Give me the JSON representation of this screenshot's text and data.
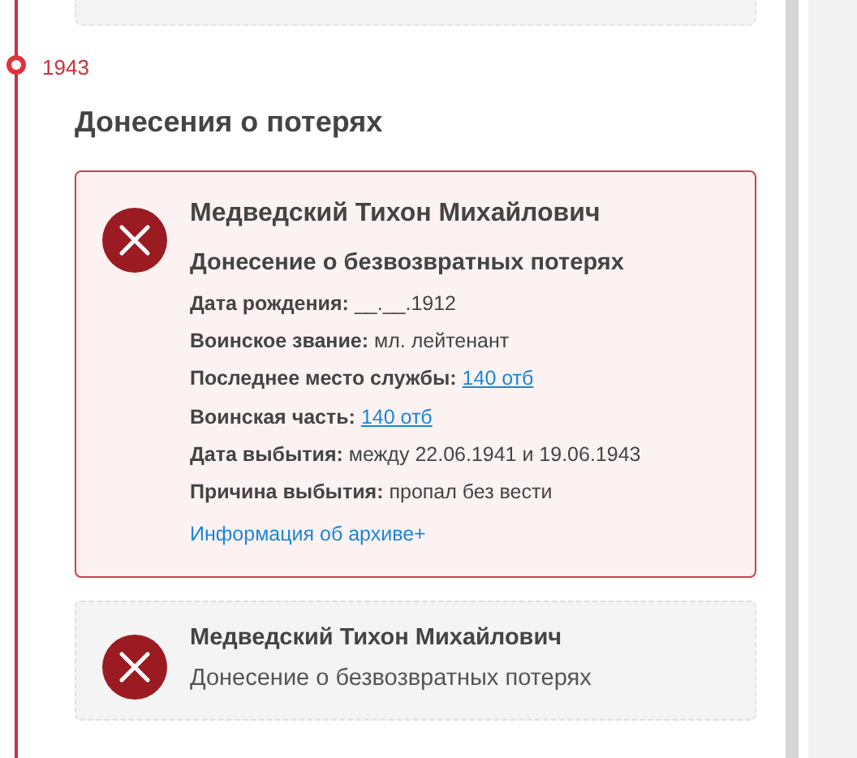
{
  "timeline": {
    "year": "1943"
  },
  "section_title": "Донесения о потерях",
  "reports": [
    {
      "name": "Медведский Тихон Михайлович",
      "doc_type": "Донесение о безвозвратных потерях",
      "selected": true,
      "fields": [
        {
          "label": "Дата рождения:",
          "value": "__.__.1912",
          "kind": "text"
        },
        {
          "label": "Воинское звание:",
          "value": "мл. лейтенант",
          "kind": "text"
        },
        {
          "label": "Последнее место службы:",
          "value": "140 отб",
          "kind": "link"
        },
        {
          "label": "Воинская часть:",
          "value": "140 отб",
          "kind": "link"
        },
        {
          "label": "Дата выбытия:",
          "value": "между 22.06.1941 и 19.06.1943",
          "kind": "text"
        },
        {
          "label": "Причина выбытия:",
          "value": "пропал без вести",
          "kind": "text"
        }
      ],
      "archive_link": "Информация об архиве+"
    },
    {
      "name": "Медведский Тихон Михайлович",
      "doc_type": "Донесение о безвозвратных потерях",
      "selected": false
    }
  ]
}
